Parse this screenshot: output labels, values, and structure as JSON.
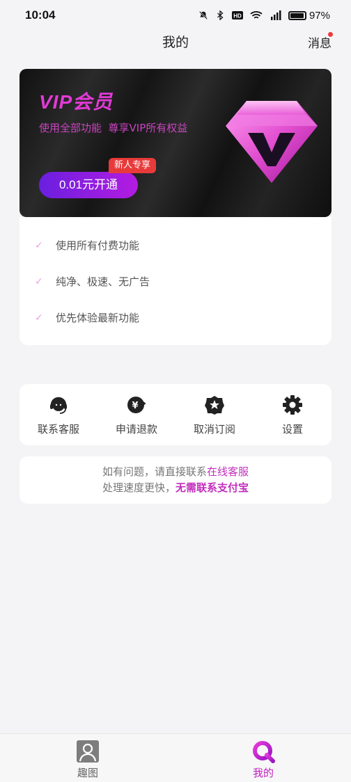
{
  "status_bar": {
    "time": "10:04",
    "battery": "97%",
    "icons": [
      "mute-bell-icon",
      "bluetooth-icon",
      "hd-icon",
      "wifi-icon",
      "cellular-signal-icon",
      "battery-icon"
    ]
  },
  "header": {
    "title": "我的",
    "messages_label": "消息",
    "has_unread": true
  },
  "vip": {
    "title": "VIP会员",
    "subtitle": "使用全部功能  尊享VIP所有权益",
    "badge": "新人专享",
    "open_button": "0.01元开通",
    "icon": "diamond-v-icon"
  },
  "benefits": [
    {
      "label": "使用所有付费功能",
      "icon": "check-icon"
    },
    {
      "label": "纯净、极速、无广告",
      "icon": "check-icon"
    },
    {
      "label": "优先体验最新功能",
      "icon": "check-icon"
    }
  ],
  "actions": [
    {
      "label": "联系客服",
      "icon": "headset-icon"
    },
    {
      "label": "申请退款",
      "icon": "refund-icon"
    },
    {
      "label": "取消订阅",
      "icon": "star-badge-icon"
    },
    {
      "label": "设置",
      "icon": "gear-icon"
    }
  ],
  "notice": {
    "line1_prefix": "如有问题，请直接联系",
    "line1_link": "在线客服",
    "line2_prefix": "处理速度更快，",
    "line2_emphasis": "无需联系支付宝"
  },
  "tab_bar": {
    "tabs": [
      {
        "label": "趣图",
        "icon": "person-icon",
        "active": false
      },
      {
        "label": "我的",
        "icon": "q-logo-icon",
        "active": true
      }
    ]
  },
  "colors": {
    "accent": "#c21fc0",
    "vip_pink": "#e23ad6",
    "button_gradient_start": "#6a1fe0",
    "button_gradient_end": "#b31ce0",
    "badge_red": "#e83a3a",
    "check_pink": "#ea9fe1"
  }
}
